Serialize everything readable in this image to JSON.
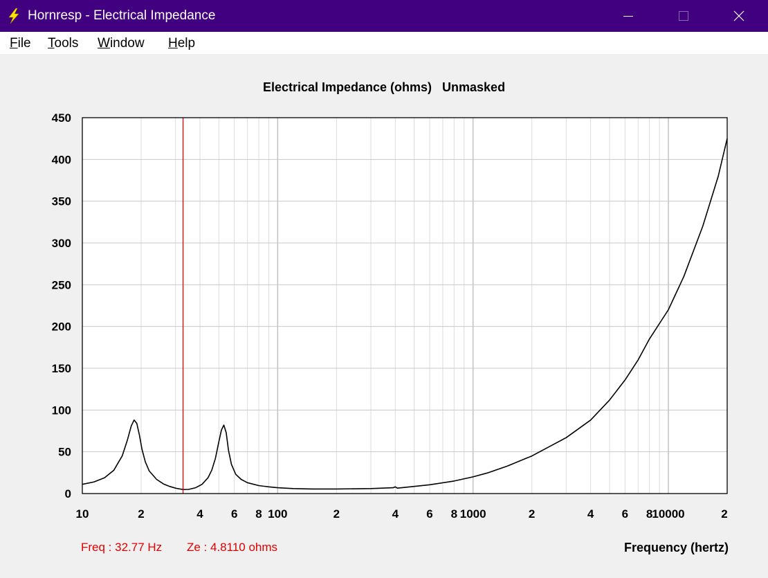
{
  "window": {
    "title": "Hornresp - Electrical Impedance",
    "colors": {
      "titlebar": "#40007f",
      "icon": "#ffe600"
    }
  },
  "menu": {
    "items": [
      {
        "accel": "F",
        "rest": "ile"
      },
      {
        "accel": "T",
        "rest": "ools"
      },
      {
        "accel": "W",
        "rest": "indow"
      },
      {
        "accel": "H",
        "rest": "elp"
      }
    ]
  },
  "status": {
    "freq": "Freq : 32.77 Hz",
    "ze": "Ze : 4.8110 ohms"
  },
  "chart_data": {
    "type": "line",
    "title": "Electrical Impedance (ohms)   Unmasked",
    "xlabel": "Frequency (hertz)",
    "ylabel": "",
    "x_scale": "log",
    "xlim": [
      10,
      20000
    ],
    "ylim": [
      0,
      450
    ],
    "y_ticks": [
      0,
      50,
      100,
      150,
      200,
      250,
      300,
      350,
      400,
      450
    ],
    "x_tick_labels": [
      {
        "x": 10,
        "label": "10"
      },
      {
        "x": 20,
        "label": "2"
      },
      {
        "x": 40,
        "label": "4"
      },
      {
        "x": 60,
        "label": "6"
      },
      {
        "x": 80,
        "label": "8"
      },
      {
        "x": 100,
        "label": "100"
      },
      {
        "x": 200,
        "label": "2"
      },
      {
        "x": 400,
        "label": "4"
      },
      {
        "x": 600,
        "label": "6"
      },
      {
        "x": 800,
        "label": "8"
      },
      {
        "x": 1000,
        "label": "1000"
      },
      {
        "x": 2000,
        "label": "2"
      },
      {
        "x": 4000,
        "label": "4"
      },
      {
        "x": 6000,
        "label": "6"
      },
      {
        "x": 8000,
        "label": "8"
      },
      {
        "x": 10000,
        "label": "10000"
      },
      {
        "x": 20000,
        "label": "2"
      }
    ],
    "grid": true,
    "cursor": {
      "x": 32.77,
      "color": "#e00000"
    },
    "series": [
      {
        "color": "#000000",
        "x": [
          10,
          11.5,
          13,
          14.5,
          16,
          17,
          17.8,
          18.4,
          19,
          19.6,
          20.2,
          21,
          22,
          24,
          26,
          28,
          30,
          32.77,
          35,
          38,
          41,
          44,
          46,
          48,
          50,
          51.5,
          53,
          54.5,
          56,
          58,
          61,
          65,
          70,
          80,
          90,
          100,
          120,
          150,
          200,
          300,
          390,
          400,
          410,
          500,
          600,
          800,
          1000,
          1200,
          1500,
          2000,
          3000,
          4000,
          5000,
          6000,
          7000,
          8000,
          10000,
          12000,
          15000,
          18000,
          20000
        ],
        "y": [
          11,
          14,
          19,
          28,
          45,
          64,
          81,
          88,
          84,
          70,
          53,
          38,
          27,
          17,
          11.5,
          8.5,
          6.5,
          4.8,
          5,
          7,
          11,
          19,
          28,
          42,
          62,
          76,
          82,
          73,
          52,
          35,
          23,
          17,
          13,
          9.5,
          8,
          7,
          6,
          5.5,
          5.5,
          6,
          7,
          8,
          6.5,
          8.5,
          10.5,
          15,
          20,
          25,
          33,
          45,
          67,
          88,
          112,
          136,
          160,
          185,
          220,
          260,
          320,
          380,
          425
        ]
      }
    ]
  }
}
